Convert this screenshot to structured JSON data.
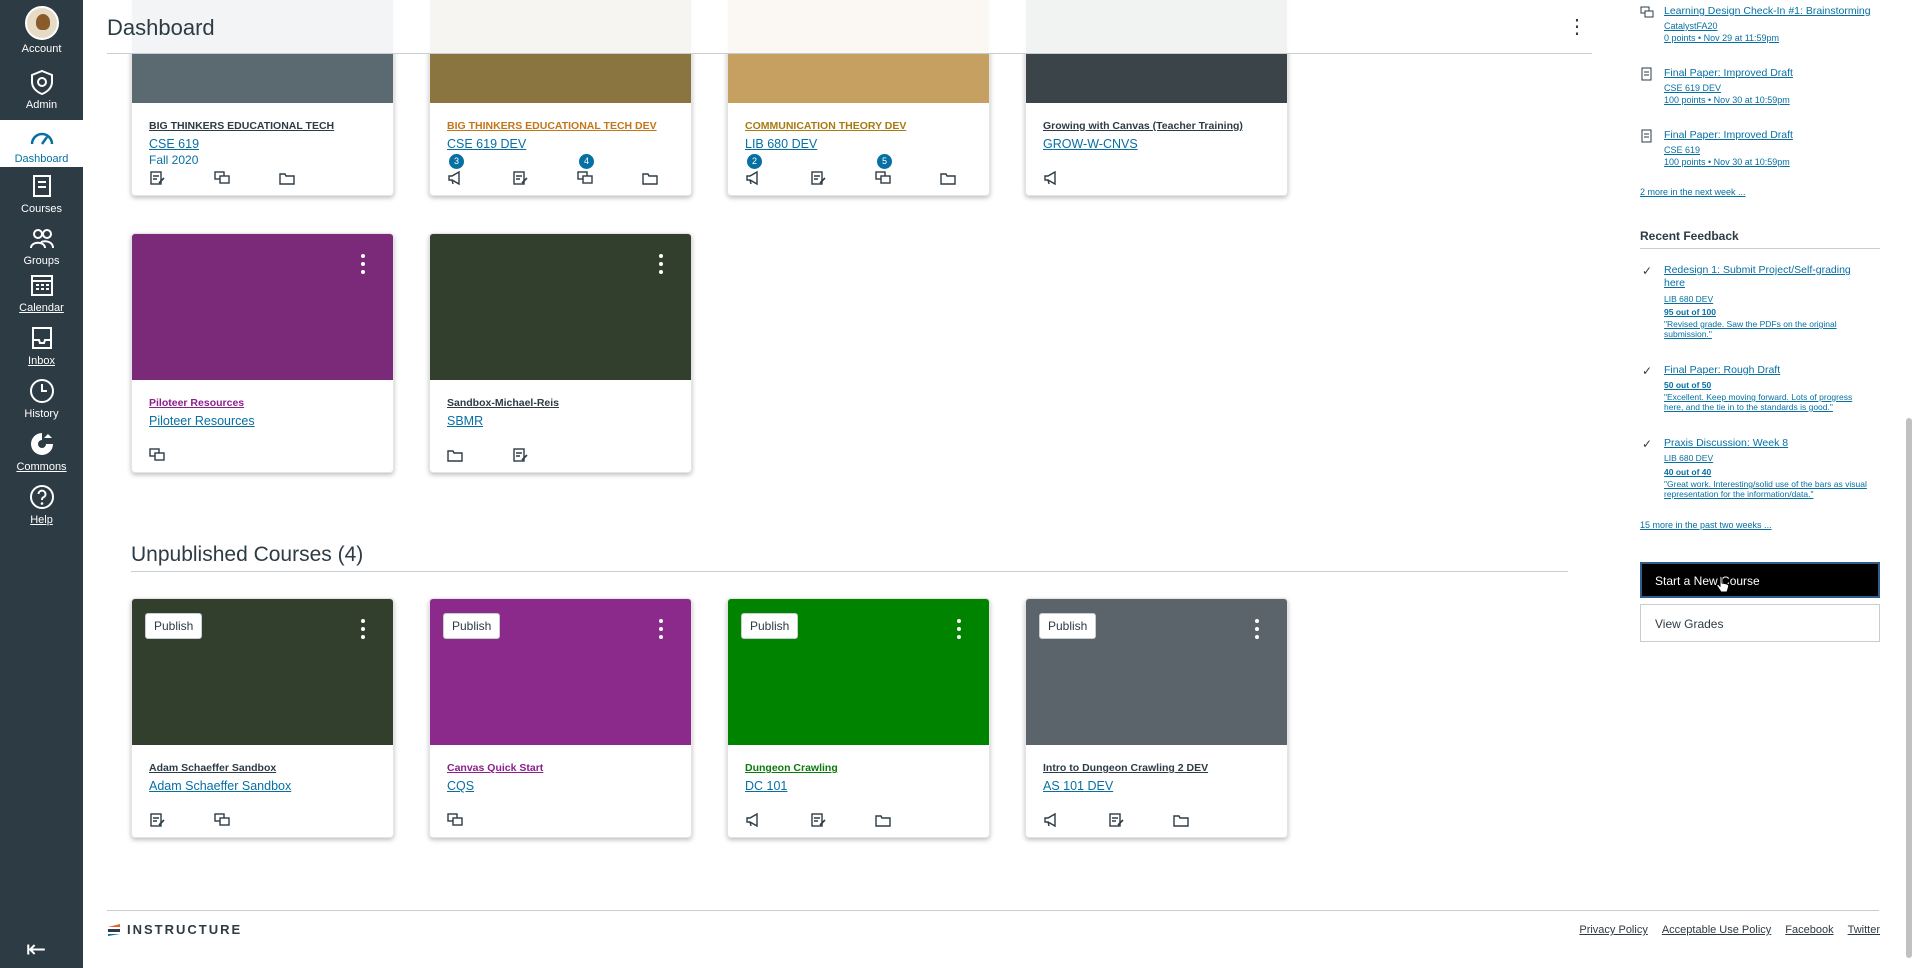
{
  "global_nav": {
    "items": [
      {
        "label": "Account",
        "icon": "avatar"
      },
      {
        "label": "Admin",
        "icon": "shield-icon"
      },
      {
        "label": "Dashboard",
        "icon": "dashboard-icon"
      },
      {
        "label": "Courses",
        "icon": "book-icon"
      },
      {
        "label": "Groups",
        "icon": "groups-icon"
      },
      {
        "label": "Calendar",
        "icon": "calendar-icon"
      },
      {
        "label": "Inbox",
        "icon": "inbox-icon"
      },
      {
        "label": "History",
        "icon": "clock-icon"
      },
      {
        "label": "Commons",
        "icon": "commons-icon"
      },
      {
        "label": "Help",
        "icon": "help-icon"
      }
    ],
    "collapse_glyph": "⇤"
  },
  "header": {
    "title": "Dashboard",
    "menu_glyph": "⋮"
  },
  "published_cards": [
    {
      "name": "BIG THINKERS EDUCATIONAL TECH",
      "code": "CSE 619",
      "term": "Fall 2020",
      "color": "#2d3b45",
      "hero": "#5a6a70",
      "badges": []
    },
    {
      "name": "BIG THINKERS EDUCATIONAL TECH DEV",
      "code": "CSE 619 DEV",
      "term": "",
      "color": "#c2761a",
      "hero": "#8a7440",
      "badges": [
        "3",
        "4"
      ]
    },
    {
      "name": "COMMUNICATION THEORY DEV",
      "code": "LIB 680 DEV",
      "term": "",
      "color": "#a77b12",
      "hero": "#c6a060",
      "badges": [
        "2",
        "5"
      ]
    },
    {
      "name": "Growing with Canvas (Teacher Training)",
      "code": "GROW-W-CNVS",
      "term": "",
      "color": "#2d3b45",
      "hero": "#3b4448",
      "badges": []
    },
    {
      "name": "Piloteer Resources",
      "code": "Piloteer Resources",
      "term": "",
      "color": "#8b1f8b",
      "hero": "#7a2a78",
      "badges": []
    },
    {
      "name": "Sandbox-Michael-Reis",
      "code": "SBMR",
      "term": "",
      "color": "#2d3b45",
      "hero": "#333f2d",
      "badges": []
    }
  ],
  "unpublished": {
    "title": "Unpublished Courses (4)",
    "publish_label": "Publish",
    "cards": [
      {
        "name": "Adam Schaeffer Sandbox",
        "code": "Adam Schaeffer Sandbox",
        "color": "#2d3b45",
        "hero": "#333f2d"
      },
      {
        "name": "Canvas Quick Start",
        "code": "CQS",
        "color": "#8b1f8b",
        "hero": "#8c2a8c"
      },
      {
        "name": "Dungeon Crawling",
        "code": "DC 101",
        "color": "#0b7a0b",
        "hero": "#008400"
      },
      {
        "name": "Intro to Dungeon Crawling 2 DEV",
        "code": "AS 101 DEV",
        "color": "#2d3b45",
        "hero": "#5b636b"
      }
    ]
  },
  "sidebar": {
    "todo": [
      {
        "title": "Learning Design Check-In #1: Brainstorming",
        "course": "CatalystFA20",
        "meta": "0 points • Nov 29 at 11:59pm",
        "icon": "discussion-icon"
      },
      {
        "title": "Final Paper: Improved Draft",
        "course": "CSE 619 DEV",
        "meta": "100 points • Nov 30 at 10:59pm",
        "icon": "assignment-icon"
      },
      {
        "title": "Final Paper: Improved Draft",
        "course": "CSE 619",
        "meta": "100 points • Nov 30 at 10:59pm",
        "icon": "assignment-icon"
      }
    ],
    "more_next_week": "2 more in the next week ...",
    "recent_feedback_title": "Recent Feedback",
    "feedback": [
      {
        "title": "Redesign 1: Submit Project/Self-grading here",
        "course": "LIB 680 DEV",
        "score": "95 out of 100",
        "comment": "\"Revised grade. Saw the PDFs on the original submission.\""
      },
      {
        "title": "Final Paper: Rough Draft",
        "course": "",
        "score": "50 out of 50",
        "comment": "\"Excellent. Keep moving forward. Lots of progress here, and the tie in to the standards is good.\""
      },
      {
        "title": "Praxis Discussion: Week 8",
        "course": "LIB 680 DEV",
        "score": "40 out of 40",
        "comment": "\"Great work. Interesting/solid use of the bars as visual representation for the information/data.\""
      }
    ],
    "more_past_two_weeks": "15 more in the past two weeks ...",
    "start_new_course": "Start a New Course",
    "view_grades": "View Grades"
  },
  "footer": {
    "logo_text": "INSTRUCTURE",
    "links": [
      "Privacy Policy",
      "Acceptable Use Policy",
      "Facebook",
      "Twitter"
    ]
  }
}
